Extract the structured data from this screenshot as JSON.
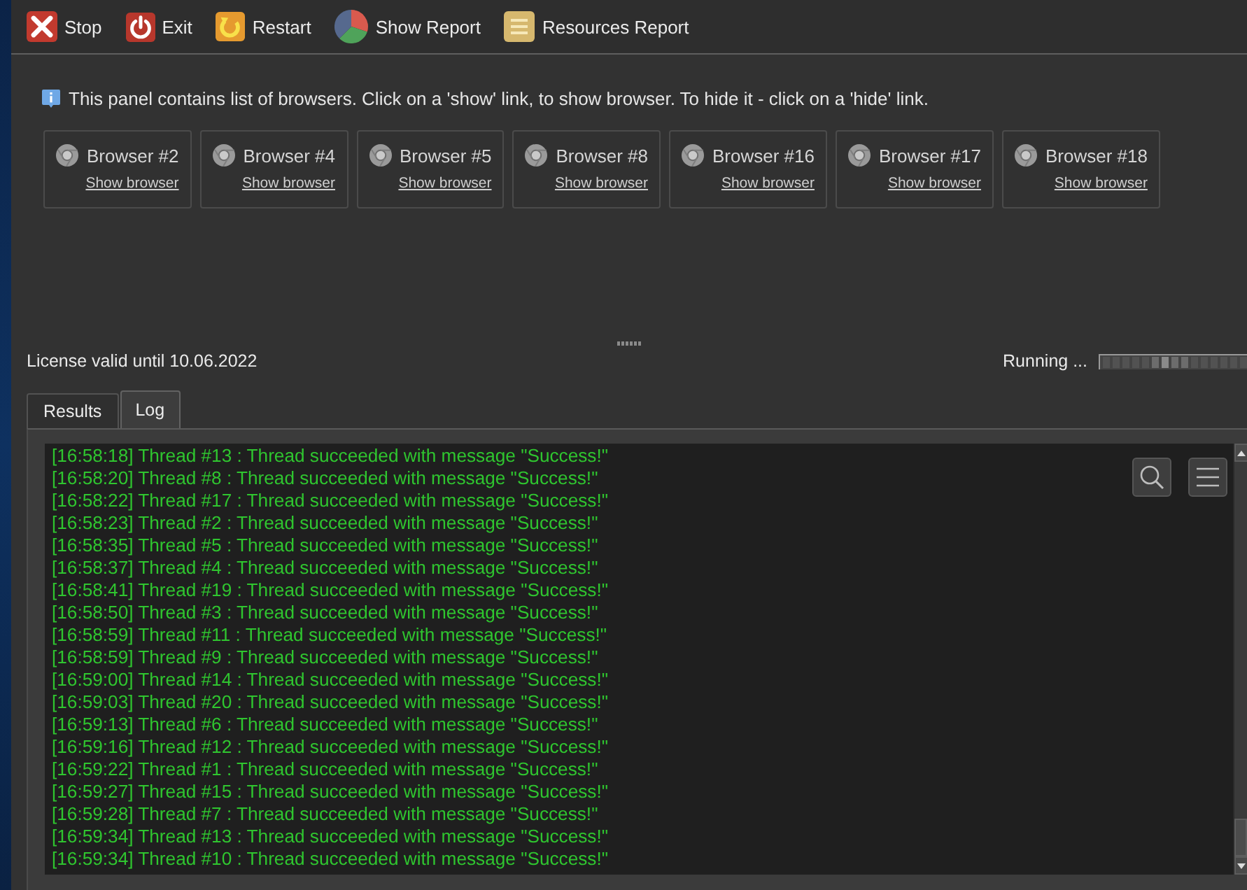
{
  "toolbar": [
    {
      "kind": "stop",
      "label": "Stop"
    },
    {
      "kind": "exit",
      "label": "Exit"
    },
    {
      "kind": "restart",
      "label": "Restart"
    },
    {
      "kind": "pie",
      "label": "Show Report"
    },
    {
      "kind": "list",
      "label": "Resources Report"
    }
  ],
  "info": {
    "text": "This panel contains list of browsers. Click on a 'show' link, to show browser. To hide it - click on a 'hide' link."
  },
  "browsers": [
    {
      "name": "Browser #2",
      "link": "Show browser"
    },
    {
      "name": "Browser #4",
      "link": "Show browser"
    },
    {
      "name": "Browser #5",
      "link": "Show browser"
    },
    {
      "name": "Browser #8",
      "link": "Show browser"
    },
    {
      "name": "Browser #16",
      "link": "Show browser"
    },
    {
      "name": "Browser #17",
      "link": "Show browser"
    },
    {
      "name": "Browser #18",
      "link": "Show browser"
    }
  ],
  "status": {
    "license": "License valid until 10.06.2022",
    "state": "Running ..."
  },
  "tabs": [
    {
      "label": "Results",
      "selected": false
    },
    {
      "label": "Log",
      "selected": true
    }
  ],
  "log": {
    "lines": [
      "[16:58:18] Thread #13 : Thread succeeded with message \"Success!\"",
      "[16:58:20] Thread #8 : Thread succeeded with message \"Success!\"",
      "[16:58:22] Thread #17 : Thread succeeded with message \"Success!\"",
      "[16:58:23] Thread #2 : Thread succeeded with message \"Success!\"",
      "[16:58:35] Thread #5 : Thread succeeded with message \"Success!\"",
      "[16:58:37] Thread #4 : Thread succeeded with message \"Success!\"",
      "[16:58:41] Thread #19 : Thread succeeded with message \"Success!\"",
      "[16:58:50] Thread #3 : Thread succeeded with message \"Success!\"",
      "[16:58:59] Thread #11 : Thread succeeded with message \"Success!\"",
      "[16:58:59] Thread #9 : Thread succeeded with message \"Success!\"",
      "[16:59:00] Thread #14 : Thread succeeded with message \"Success!\"",
      "[16:59:03] Thread #20 : Thread succeeded with message \"Success!\"",
      "[16:59:13] Thread #6 : Thread succeeded with message \"Success!\"",
      "[16:59:16] Thread #12 : Thread succeeded with message \"Success!\"",
      "[16:59:22] Thread #1 : Thread succeeded with message \"Success!\"",
      "[16:59:27] Thread #15 : Thread succeeded with message \"Success!\"",
      "[16:59:28] Thread #7 : Thread succeeded with message \"Success!\"",
      "[16:59:34] Thread #13 : Thread succeeded with message \"Success!\"",
      "[16:59:34] Thread #10 : Thread succeeded with message \"Success!\""
    ]
  }
}
